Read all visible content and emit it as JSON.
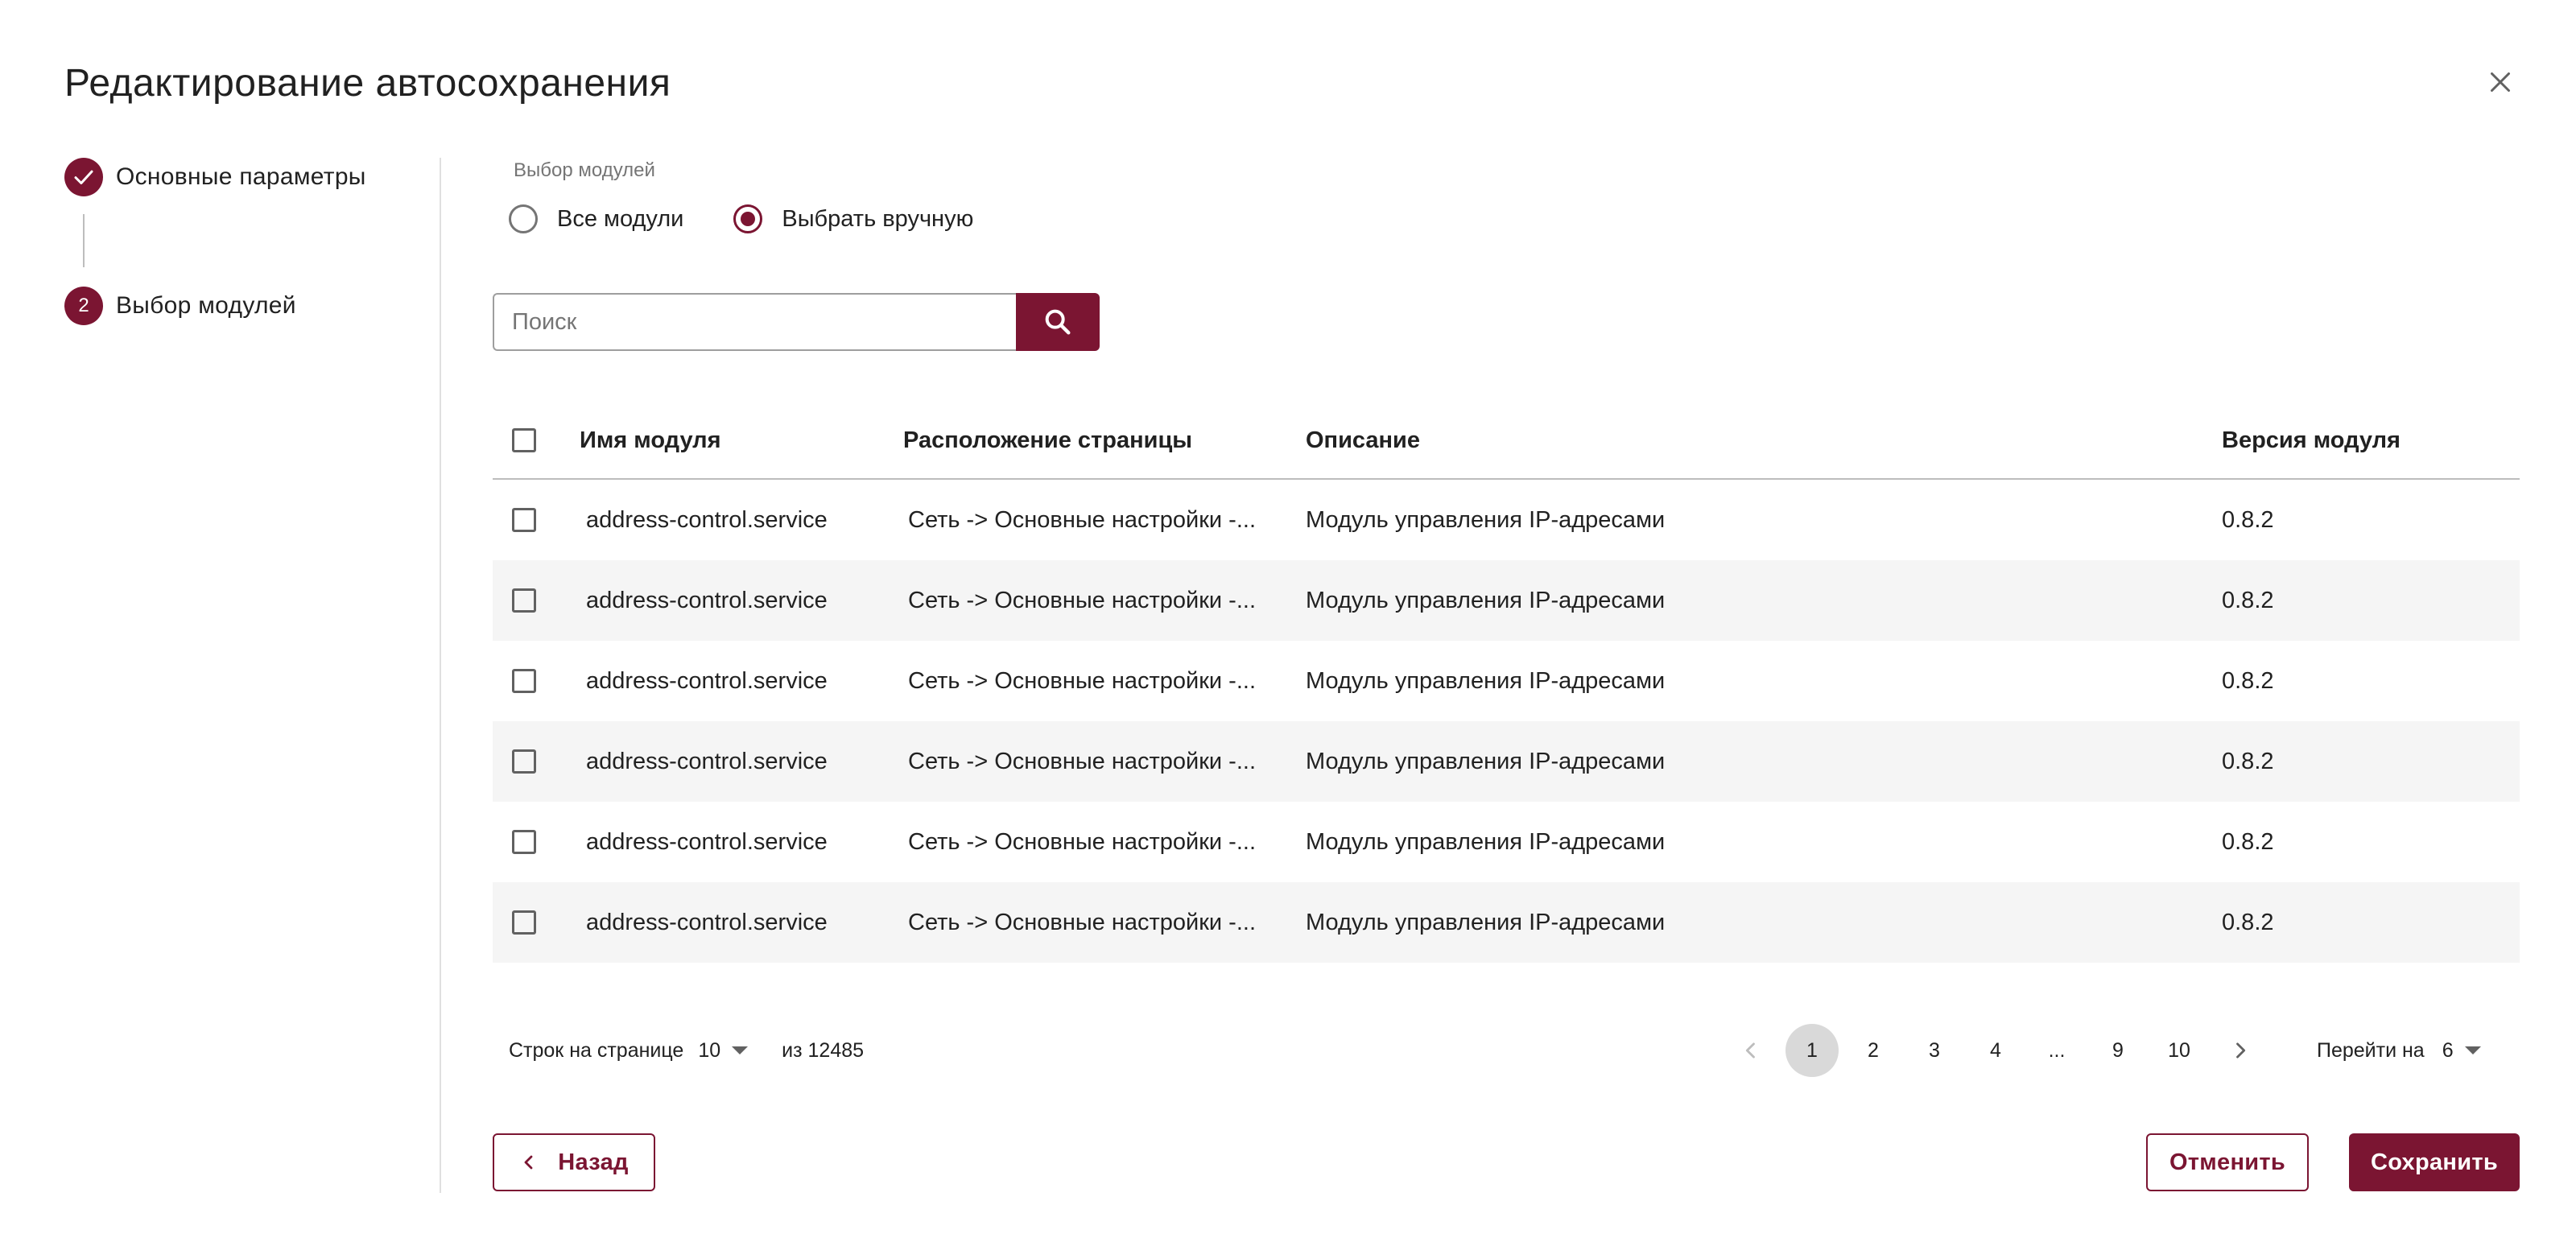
{
  "dialog": {
    "title": "Редактирование автосохранения",
    "close_icon": "close-icon"
  },
  "stepper": {
    "steps": [
      {
        "number": "1",
        "label": "Основные параметры",
        "state": "completed",
        "icon": "check-icon"
      },
      {
        "number": "2",
        "label": "Выбор модулей",
        "state": "active"
      }
    ]
  },
  "module_selection": {
    "label": "Выбор модулей",
    "options": [
      {
        "label": "Все модули",
        "checked": false
      },
      {
        "label": "Выбрать вручную",
        "checked": true
      }
    ]
  },
  "search": {
    "placeholder": "Поиск",
    "value": "",
    "icon": "search-icon"
  },
  "table": {
    "columns": [
      "Имя модуля",
      "Расположение страницы",
      "Описание",
      "Версия модуля"
    ],
    "rows": [
      {
        "name": "address-control.service",
        "location": "Сеть -> Основные настройки -...",
        "description": "Модуль управления IP-адресами",
        "version": "0.8.2",
        "checked": false
      },
      {
        "name": "address-control.service",
        "location": "Сеть -> Основные настройки -...",
        "description": "Модуль управления IP-адресами",
        "version": "0.8.2",
        "checked": false
      },
      {
        "name": "address-control.service",
        "location": "Сеть -> Основные настройки -...",
        "description": "Модуль управления IP-адресами",
        "version": "0.8.2",
        "checked": false
      },
      {
        "name": "address-control.service",
        "location": "Сеть -> Основные настройки -...",
        "description": "Модуль управления IP-адресами",
        "version": "0.8.2",
        "checked": false
      },
      {
        "name": "address-control.service",
        "location": "Сеть -> Основные настройки -...",
        "description": "Модуль управления IP-адресами",
        "version": "0.8.2",
        "checked": false
      },
      {
        "name": "address-control.service",
        "location": "Сеть -> Основные настройки -...",
        "description": "Модуль управления IP-адресами",
        "version": "0.8.2",
        "checked": false
      }
    ]
  },
  "pagination": {
    "rows_per_page_label": "Строк на странице",
    "rows_per_page_value": "10",
    "total_label": "из 12485",
    "pages": [
      "1",
      "2",
      "3",
      "4",
      "...",
      "9",
      "10"
    ],
    "current_page": "1",
    "goto_label": "Перейти на",
    "goto_value": "6"
  },
  "footer": {
    "back_label": "Назад",
    "cancel_label": "Отменить",
    "save_label": "Сохранить"
  },
  "colors": {
    "accent": "#7b1532",
    "row_alt": "#f5f5f5",
    "active_page": "#d9d9d9"
  }
}
